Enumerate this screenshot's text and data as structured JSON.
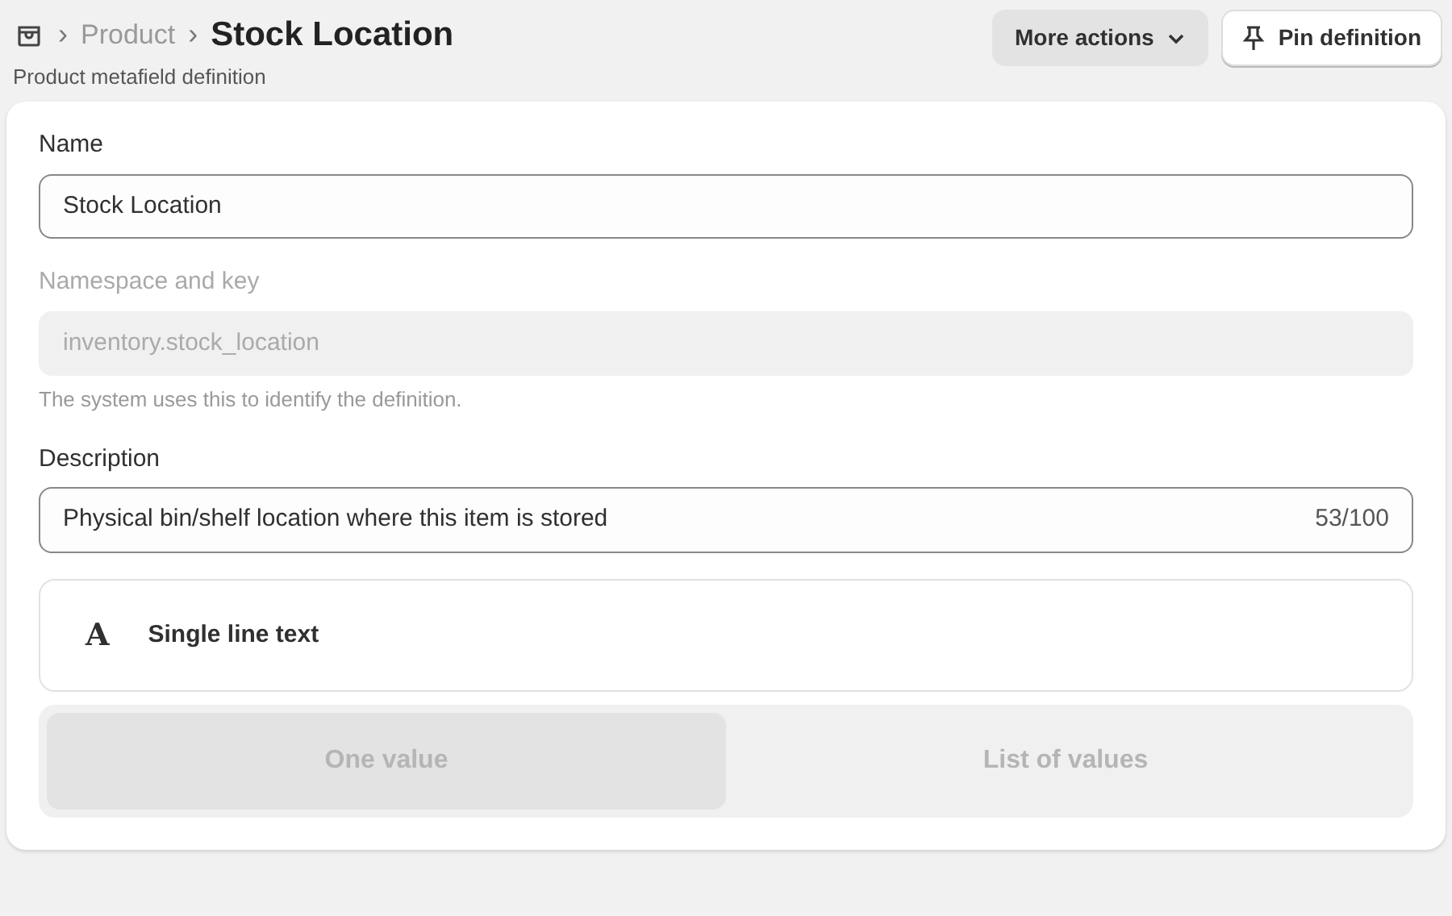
{
  "breadcrumb": {
    "items": [
      {
        "label": "Product",
        "faded": true
      },
      {
        "label": "Stock Location",
        "faded": false
      }
    ],
    "separator": "›"
  },
  "subtitle": "Product metafield definition",
  "actions": [
    {
      "label": "More actions",
      "kind": "menu"
    },
    {
      "label": "Pin definition",
      "kind": "pin"
    }
  ],
  "fields": [
    {
      "label": "Name",
      "value": "Stock Location",
      "disabled": false
    },
    {
      "label": "Namespace and key",
      "value": "inventory.stock_location",
      "disabled": true,
      "help": "The system uses this to identify the definition."
    },
    {
      "label": "Description",
      "value": "Physical bin/shelf location where this item is stored",
      "disabled": false,
      "counter": "53/100"
    }
  ],
  "type": {
    "glyph": "A",
    "label": "Single line text"
  },
  "value_options": [
    {
      "label": "One value",
      "selected": true,
      "disabled": true
    },
    {
      "label": "List of values",
      "selected": false,
      "disabled": true
    }
  ]
}
